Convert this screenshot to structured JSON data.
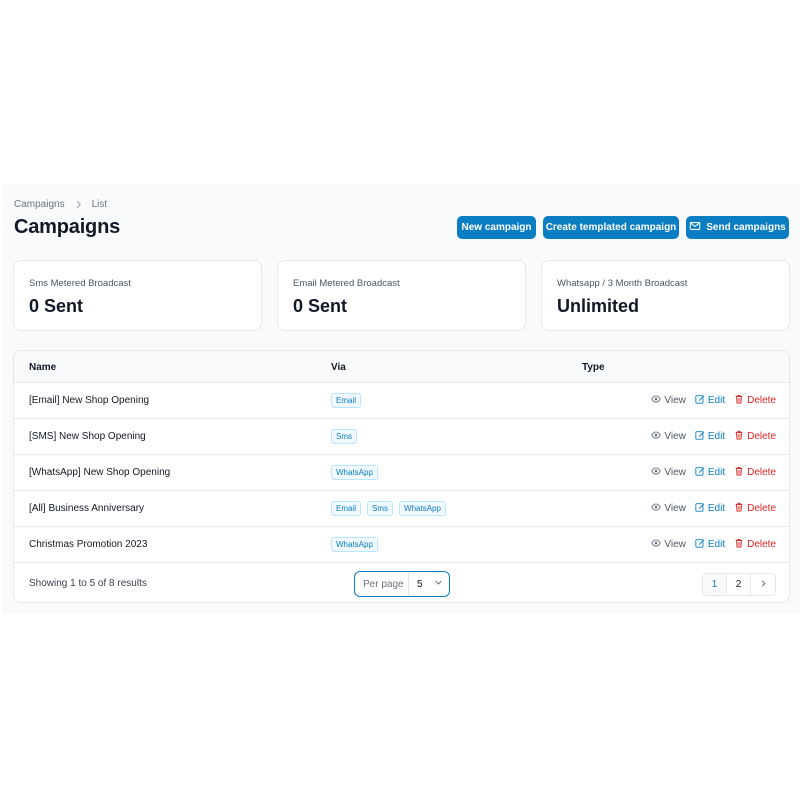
{
  "breadcrumb": {
    "root": "Campaigns",
    "current": "List"
  },
  "page_title": "Campaigns",
  "header_buttons": {
    "new_campaign": "New campaign",
    "create_templated": "Create templated campaign",
    "send_campaigns": "Send campaigns"
  },
  "stats": [
    {
      "label": "Sms Metered Broadcast",
      "value": "0 Sent"
    },
    {
      "label": "Email Metered Broadcast",
      "value": "0 Sent"
    },
    {
      "label": "Whatsapp / 3 Month Broadcast",
      "value": "Unlimited"
    }
  ],
  "table": {
    "columns": {
      "name": "Name",
      "via": "Via",
      "type": "Type"
    },
    "rows": [
      {
        "name": "[Email] New Shop Opening",
        "via": [
          "Email"
        ]
      },
      {
        "name": "[SMS] New Shop Opening",
        "via": [
          "Sms"
        ]
      },
      {
        "name": "[WhatsApp] New Shop Opening",
        "via": [
          "WhatsApp"
        ]
      },
      {
        "name": "[All] Business Anniversary",
        "via": [
          "Email",
          "Sms",
          "WhatsApp"
        ]
      },
      {
        "name": "Christmas Promotion 2023",
        "via": [
          "WhatsApp"
        ]
      }
    ],
    "actions": {
      "view": "View",
      "edit": "Edit",
      "delete": "Delete"
    }
  },
  "footer": {
    "results": "Showing 1 to 5 of 8 results",
    "per_page_label": "Per page",
    "per_page_value": "5",
    "pages": [
      "1",
      "2"
    ],
    "current_page": "1"
  },
  "colors": {
    "primary": "#0b7dc2",
    "danger": "#dc2626",
    "muted": "#6b7280"
  }
}
